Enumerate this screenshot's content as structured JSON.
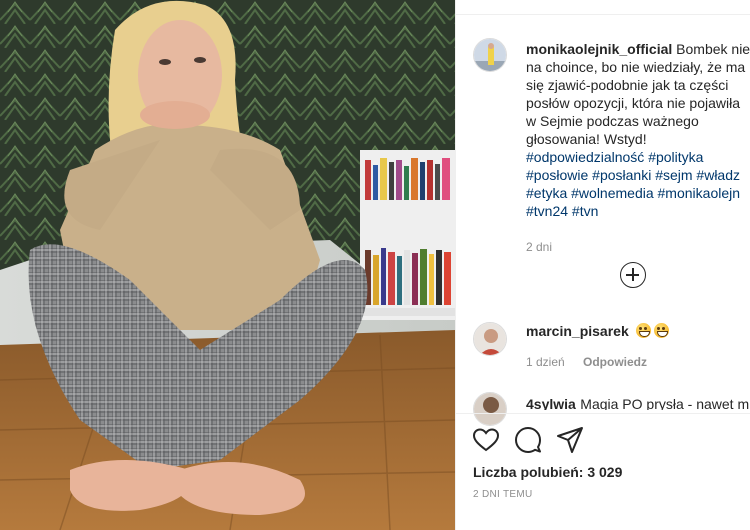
{
  "post": {
    "username": "monikaolejnik_official",
    "caption_lines": [
      "Bombek nie",
      "na choince, bo nie wiedziały, że ma",
      "się zjawić-podobnie jak ta części",
      "posłów opozycji, która nie pojawiła",
      "w Sejmie podczas ważnego",
      "głosowania! Wstyd!"
    ],
    "hashtag_lines": [
      "#odpowiedzialność #polityka",
      "#posłowie #posłanki #sejm #władz",
      "#etyka #wolnemedia #monikaolejn",
      "#tvn24 #tvn"
    ],
    "time_ago": "2 dni"
  },
  "comments": [
    {
      "username": "marcin_pisarek",
      "text": "",
      "emoji_count": 2,
      "time_ago": "1 dzień",
      "reply_label": "Odpowiedz"
    },
    {
      "username": "4sylwia",
      "text": "Magia PO prysła - nawet m"
    }
  ],
  "actions": {
    "like_icon": "heart-icon",
    "comment_icon": "comment-icon",
    "share_icon": "share-icon"
  },
  "likes_text": "Liczba polubień: 3 029",
  "date_text": "2 DNI TEMU",
  "colors": {
    "hashtag": "#00376b",
    "muted": "#8e8e8e",
    "text": "#262626"
  }
}
